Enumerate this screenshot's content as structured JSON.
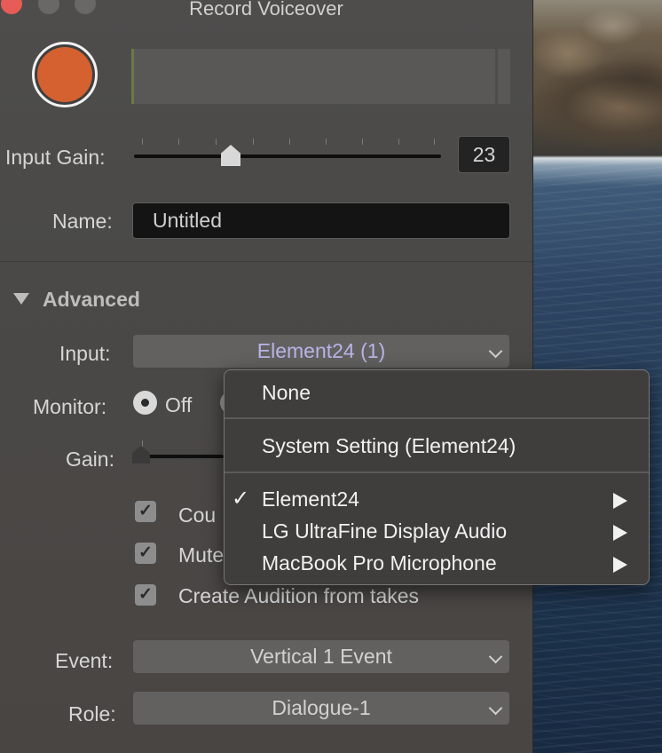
{
  "window": {
    "title": "Record Voiceover",
    "traffic_colors": {
      "close": "#e75c56",
      "inactive": "#6a6866"
    }
  },
  "record": {
    "color": "#d4612f"
  },
  "input_gain": {
    "label": "Input Gain:",
    "value": "23",
    "level": 0.23
  },
  "name": {
    "label": "Name:",
    "value": "Untitled"
  },
  "advanced": {
    "title": "Advanced",
    "input": {
      "label": "Input:",
      "value": "Element24 (1)",
      "value_color": "#b9b4e8"
    },
    "monitor": {
      "label": "Monitor:",
      "off_label": "Off"
    },
    "gain": {
      "label": "Gain:"
    },
    "checkboxes": [
      {
        "label": "Cou",
        "checked": true
      },
      {
        "label": "Mute",
        "checked": true
      },
      {
        "label": "Create Audition from takes",
        "checked": true
      }
    ],
    "event": {
      "label": "Event:",
      "value": "Vertical 1 Event"
    },
    "role": {
      "label": "Role:",
      "value": "Dialogue-1"
    }
  },
  "input_menu": {
    "none": "None",
    "system": "System Setting (Element24)",
    "devices": [
      {
        "label": "Element24",
        "checked": true,
        "submenu": true
      },
      {
        "label": "LG UltraFine Display Audio",
        "checked": false,
        "submenu": true
      },
      {
        "label": "MacBook Pro Microphone",
        "checked": false,
        "submenu": true
      }
    ],
    "checkmark": "✓"
  }
}
